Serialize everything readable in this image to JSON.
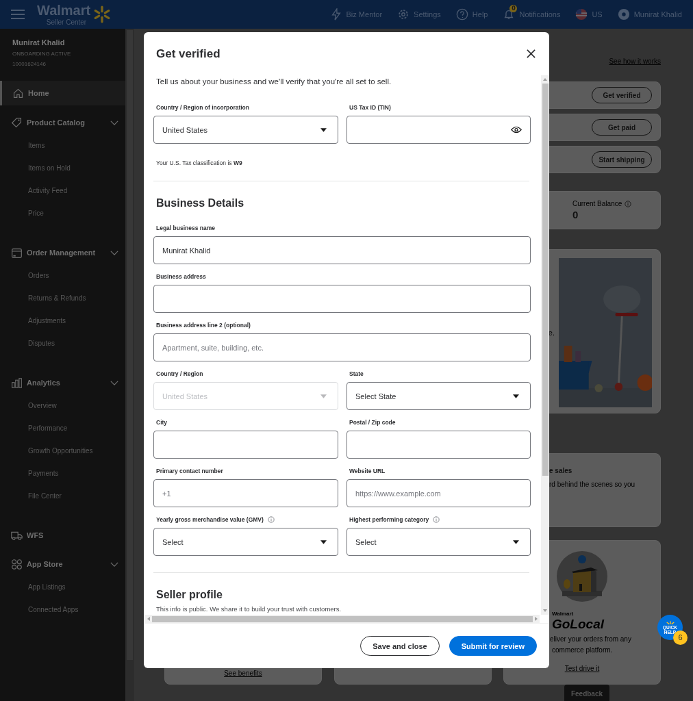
{
  "header": {
    "logo": {
      "name": "Walmart",
      "sub": "Seller Center"
    },
    "nav": [
      {
        "label": "Biz Mentor",
        "kind": "bolt"
      },
      {
        "label": "Settings",
        "kind": "gear"
      },
      {
        "label": "Help",
        "kind": "help"
      },
      {
        "label": "Notifications",
        "kind": "bell",
        "badge": "0"
      },
      {
        "label": "US",
        "kind": "flag"
      },
      {
        "label": "Munirat Khalid",
        "kind": "avatar"
      }
    ]
  },
  "sidebar": {
    "account": {
      "name": "Munirat Khalid",
      "status": "ONBOARDING ACTIVE",
      "id": "10001624146"
    },
    "items": [
      {
        "label": "Home",
        "kind": "home",
        "selected": true,
        "expanded": false
      },
      {
        "label": "Product Catalog",
        "kind": "tag",
        "selected": false,
        "expanded": true,
        "children": [
          {
            "label": "Items",
            "selected": false
          },
          {
            "label": "Items on Hold",
            "selected": false
          },
          {
            "label": "Activity Feed",
            "selected": false
          },
          {
            "label": "Price",
            "selected": false
          }
        ]
      },
      {
        "label": "Order Management",
        "kind": "box",
        "selected": false,
        "expanded": true,
        "children": [
          {
            "label": "Orders",
            "selected": false
          },
          {
            "label": "Returns & Refunds",
            "selected": false
          },
          {
            "label": "Adjustments",
            "selected": false
          },
          {
            "label": "Disputes",
            "selected": false
          }
        ]
      },
      {
        "label": "Analytics",
        "kind": "chart",
        "selected": false,
        "expanded": true,
        "children": [
          {
            "label": "Overview",
            "selected": false
          },
          {
            "label": "Performance",
            "selected": false
          },
          {
            "label": "Growth Opportunities",
            "selected": false
          },
          {
            "label": "Payments",
            "selected": false
          },
          {
            "label": "File Center",
            "selected": false
          }
        ]
      },
      {
        "label": "WFS",
        "kind": "truck",
        "selected": false,
        "expanded": false
      },
      {
        "label": "App Store",
        "kind": "apps",
        "selected": false,
        "expanded": true,
        "children": [
          {
            "label": "App Listings",
            "selected": false
          },
          {
            "label": "Connected Apps",
            "selected": false
          }
        ]
      }
    ]
  },
  "main": {
    "link": "See how it works",
    "actions": [
      "Get verified",
      "Get paid",
      "Start shipping"
    ],
    "balance": {
      "label": "Current Balance",
      "value": "0"
    },
    "promo": {
      "text": "e.",
      "kind": "picture"
    },
    "sales": {
      "title": "e sales",
      "text": "rd behind the scenes so you"
    },
    "cards": [
      {
        "link": "See benefits"
      }
    ],
    "golocal": {
      "brand": "Walmart",
      "name": "GoLocal",
      "lines": [
        "eliver your orders from any",
        "commerce platform."
      ],
      "link": "Test drive it"
    },
    "feedback": "Feedback",
    "quick_help": {
      "label": "QUICK HELP",
      "count": "6"
    }
  },
  "modal": {
    "title": "Get verified",
    "intro": "Tell us about your business and we'll verify that you're all set to sell.",
    "sections": [
      {
        "fields": [
          {
            "label": "Country / Region of incorporation",
            "kind": "select",
            "value": "United States",
            "disabled": false
          },
          {
            "label": "US Tax ID (TIN)",
            "kind": "secret",
            "disabled": false
          }
        ],
        "note": "Your U.S. Tax classification is **W9**"
      },
      {
        "heading": "Business Details",
        "fields": [
          {
            "label": "Legal business name",
            "kind": "text",
            "wide": true,
            "value": "Munirat Khalid",
            "disabled": false
          },
          {
            "label": "Business address",
            "kind": "text",
            "wide": true,
            "disabled": false
          },
          {
            "label": "Business address line 2 (optional)",
            "kind": "text",
            "wide": true,
            "placeholder": "Apartment, suite, building, etc.",
            "disabled": false
          },
          {
            "label": "Country / Region",
            "kind": "select",
            "value": "United States",
            "disabled": true
          },
          {
            "label": "State",
            "kind": "select",
            "value": "Select State",
            "disabled": false
          },
          {
            "label": "City",
            "kind": "text",
            "disabled": false
          },
          {
            "label": "Postal / Zip code",
            "kind": "text",
            "disabled": false
          },
          {
            "label": "Primary contact number",
            "kind": "text",
            "placeholder": "+1",
            "disabled": false
          },
          {
            "label": "Website URL",
            "kind": "text",
            "placeholder": "https://www.example.com",
            "disabled": false
          },
          {
            "label": "Yearly gross merchandise value (GMV)",
            "kind": "select",
            "info": true,
            "value": "Select",
            "disabled": false
          },
          {
            "label": "Highest performing category",
            "kind": "select",
            "info": true,
            "value": "Select",
            "disabled": false
          }
        ]
      },
      {
        "heading": "Seller profile",
        "description": "This info is public. We share it to build your trust with customers."
      }
    ],
    "buttons": [
      {
        "label": "Save and close",
        "kind": "secondary"
      },
      {
        "label": "Submit for review",
        "kind": "primary"
      }
    ]
  }
}
